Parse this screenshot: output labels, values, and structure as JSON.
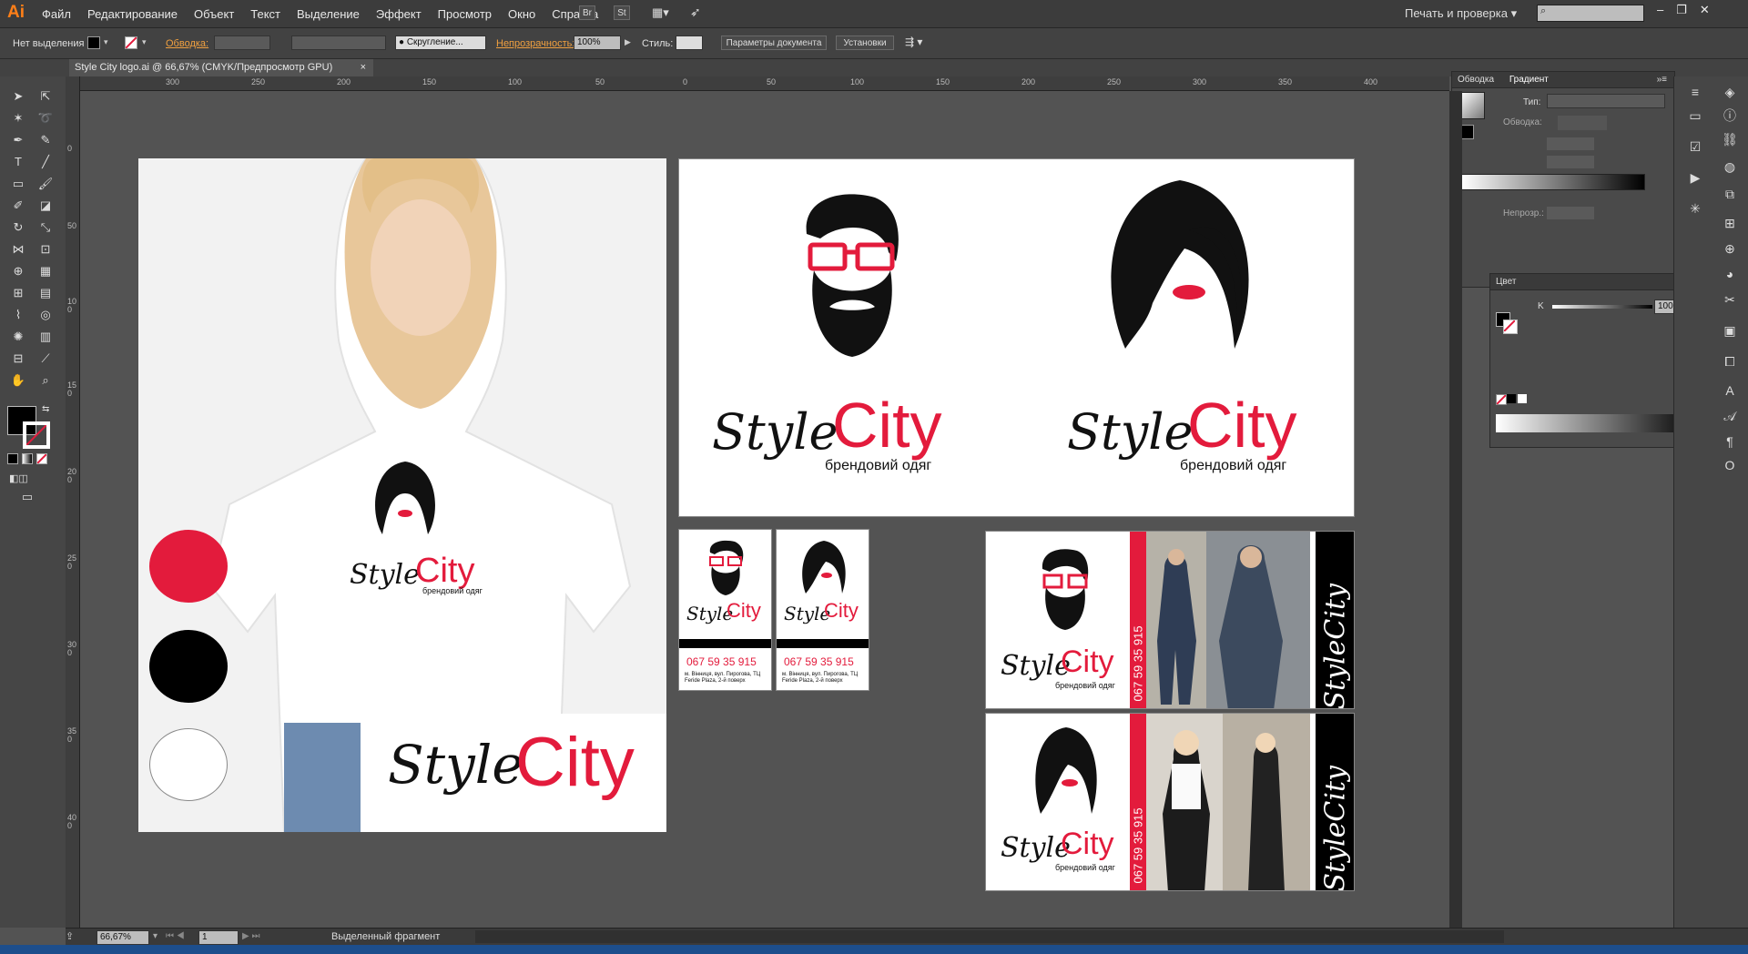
{
  "menubar": {
    "app_logo": "Ai",
    "items": [
      "Файл",
      "Редактирование",
      "Объект",
      "Текст",
      "Выделение",
      "Эффект",
      "Просмотр",
      "Окно",
      "Справка"
    ],
    "bridge_label": "Br",
    "stock_label": "St",
    "workspace": "Печать и проверка",
    "window_controls": [
      "–",
      "❐",
      "✕"
    ]
  },
  "controlbar": {
    "selection_label": "Нет выделения",
    "stroke_label": "Обводка:",
    "brush_label": "Скругление...",
    "opacity_label": "Непрозрачность:",
    "opacity_value": "100%",
    "style_label": "Стиль:",
    "doc_settings_button": "Параметры документа",
    "preferences_button": "Установки"
  },
  "document_tab": {
    "title": "Style City logo.ai @ 66,67% (CMYK/Предпросмотр GPU)",
    "close": "×"
  },
  "ruler": {
    "top_labels": [
      "300",
      "250",
      "200",
      "150",
      "100",
      "50",
      "0",
      "50",
      "100",
      "150",
      "200",
      "250",
      "300",
      "350",
      "400"
    ],
    "left_labels": [
      "0",
      "50",
      "100",
      "150",
      "200",
      "250",
      "300",
      "350",
      "400"
    ]
  },
  "artwork": {
    "brand_style": "Style",
    "brand_city": "City",
    "tagline": "брендовий одяг",
    "phone": "067 59 35 915",
    "address": "м. Вінниця, вул. Пирогова, ТЦ Feride Plaza, 2-й поверх",
    "vertical_address": "м. Вінниця, вул. Пирогова, ТЦ Feride Plaza, 2-й поверх",
    "vertical_brand": "StyleCity",
    "palette": [
      "#e31b3c",
      "#000000",
      "#ffffff"
    ]
  },
  "panels": {
    "gradient": {
      "tab_stroke": "Обводка",
      "tab_gradient": "Градиент",
      "type_label": "Тип:",
      "stroke_label": "Обводка:",
      "opacity_label": "Непрозр.:"
    },
    "color": {
      "title": "Цвет",
      "channel_label": "K",
      "channel_value": "100",
      "channel_unit": "%"
    }
  },
  "statusbar": {
    "zoom": "66,67%",
    "artboard_number": "1",
    "status_text": "Выделенный фрагмент"
  },
  "colors": {
    "brand_red": "#e31b3c",
    "ui_orange": "#ff7f18"
  }
}
